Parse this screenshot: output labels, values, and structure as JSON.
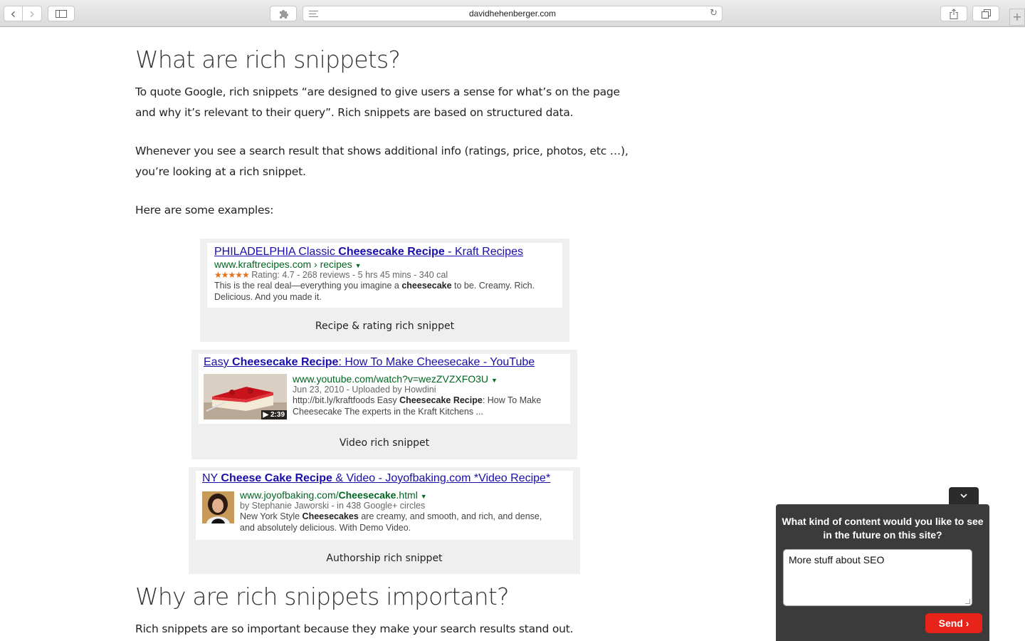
{
  "browser": {
    "url": "davidhehenberger.com",
    "back_glyph": "‹",
    "forward_glyph": "›",
    "reload_glyph": "↻",
    "new_tab_glyph": "+"
  },
  "article": {
    "heading1": "What are rich snippets?",
    "para1_line1": "To quote Google, rich snippets “are designed to give users a sense for what’s on the page",
    "para1_line2": "and why it’s relevant to their query”. Rich snippets are based on structured data.",
    "para2_line1": "Whenever you see a search result that shows additional info (ratings, price, photos, etc …),",
    "para2_line2": "you’re looking at a rich snippet.",
    "para3": "Here are some examples:",
    "heading2": "Why are rich snippets important?",
    "para4": "Rich snippets are so important because they make your search results stand out."
  },
  "examples": [
    {
      "title_pre": "PHILADELPHIA Classic ",
      "title_bold": "Cheesecake Recipe",
      "title_post": " - Kraft Recipes",
      "url": "www.kraftrecipes.com › recipes",
      "stars": "★★★★★",
      "meta": "Rating: 4.7 - 268 reviews - 5 hrs 45 mins - 340 cal",
      "desc_pre": "This is the real deal—everything you imagine a ",
      "desc_bold": "cheesecake",
      "desc_post": " to be. Creamy. Rich.",
      "desc_line2": "Delicious. And you made it.",
      "caption": "Recipe & rating rich snippet"
    },
    {
      "title_pre": "Easy ",
      "title_bold": "Cheesecake Recipe",
      "title_post": ": How To Make Cheesecake - YouTube",
      "url": "www.youtube.com/watch?v=wezZVZXFO3U",
      "meta": "Jun 23, 2010 - Uploaded by Howdini",
      "desc_pre": "http://bit.ly/kraftfoods Easy ",
      "desc_bold": "Cheesecake Recipe",
      "desc_post": ": How To Make",
      "desc_line2": "Cheesecake The experts in the Kraft Kitchens ...",
      "duration": "▶ 2:39",
      "caption": "Video rich snippet"
    },
    {
      "title_pre": "NY ",
      "title_bold": "Cheese Cake Recipe",
      "title_post": " & Video - Joyofbaking.com *Video Recipe*",
      "url_pre": "www.joyofbaking.com/",
      "url_bold": "Cheesecake",
      "url_post": ".html",
      "meta": "by Stephanie Jaworski - in 438 Google+ circles",
      "desc_pre": "New York Style ",
      "desc_bold": "Cheesecakes",
      "desc_post": " are creamy, and smooth, and rich, and dense,",
      "desc_line2": "and absolutely delicious. With Demo Video.",
      "caption": "Authorship rich snippet"
    }
  ],
  "feedback": {
    "question": "What kind of content would you like to see in the future on this site?",
    "answer": "More stuff about SEO",
    "send_label": "Send ›",
    "collapse_glyph": "⌄"
  }
}
